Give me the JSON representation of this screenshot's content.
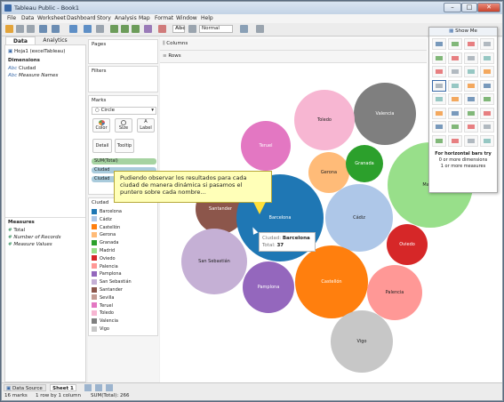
{
  "window": {
    "title": "Tableau Public - Book1",
    "minimize": "–",
    "maximize": "□",
    "close": "✕"
  },
  "menu": [
    "File",
    "Data",
    "Worksheet",
    "Dashboard",
    "Story",
    "Analysis",
    "Map",
    "Format",
    "Window",
    "Help"
  ],
  "toolbar": {
    "text_icon": "Abc",
    "fit": "Normal"
  },
  "tabs": {
    "data": "Data",
    "analytics": "Analytics"
  },
  "data_panel": {
    "source": "Hoja1 (excelTableau)",
    "dimensions_header": "Dimensions",
    "dimensions": [
      {
        "icon": "Abc",
        "label": "Ciudad"
      },
      {
        "icon": "Abc",
        "label": "Measure Names"
      }
    ],
    "measures_header": "Measures",
    "measures": [
      {
        "icon": "#",
        "label": "Total"
      },
      {
        "icon": "#",
        "label": "Number of Records"
      },
      {
        "icon": "#",
        "label": "Measure Values"
      }
    ]
  },
  "cards": {
    "pages": "Pages",
    "filters": "Filters",
    "marks": "Marks",
    "mark_type": "Circle",
    "color": "Color",
    "size": "Size",
    "label": "Label",
    "detail": "Detail",
    "tooltip": "Tooltip",
    "pill_sum": "SUM(Total)",
    "pill_ciudad1": "Ciudad",
    "pill_ciudad2": "Ciudad"
  },
  "legend": {
    "title": "Ciudad",
    "items": [
      {
        "label": "Barcelona",
        "color": "#1f77b4"
      },
      {
        "label": "Cádiz",
        "color": "#aec7e8"
      },
      {
        "label": "Castellón",
        "color": "#ff7f0e"
      },
      {
        "label": "Gerona",
        "color": "#ffbb78"
      },
      {
        "label": "Granada",
        "color": "#2ca02c"
      },
      {
        "label": "Madrid",
        "color": "#98df8a"
      },
      {
        "label": "Oviedo",
        "color": "#d62728"
      },
      {
        "label": "Palencia",
        "color": "#ff9896"
      },
      {
        "label": "Pamplona",
        "color": "#9467bd"
      },
      {
        "label": "San Sebastián",
        "color": "#c5b0d5"
      },
      {
        "label": "Santander",
        "color": "#8c564b"
      },
      {
        "label": "Sevilla",
        "color": "#c49c94"
      },
      {
        "label": "Teruel",
        "color": "#e377c2"
      },
      {
        "label": "Toledo",
        "color": "#f7b6d2"
      },
      {
        "label": "Valencia",
        "color": "#7f7f7f"
      },
      {
        "label": "Vigo",
        "color": "#c7c7c7"
      }
    ]
  },
  "shelves": {
    "columns": "Columns",
    "rows": "Rows"
  },
  "bubbles": [
    {
      "label": "Valencia",
      "color": "#7f7f7f"
    },
    {
      "label": "Toledo",
      "color": "#f7b6d2"
    },
    {
      "label": "Teruel",
      "color": "#e377c2"
    },
    {
      "label": "Gerona",
      "color": "#ffbb78"
    },
    {
      "label": "Granada",
      "color": "#2ca02c"
    },
    {
      "label": "Madrid",
      "color": "#98df8a"
    },
    {
      "label": "Santander",
      "color": "#8c564b"
    },
    {
      "label": "Barcelona",
      "color": "#1f77b4"
    },
    {
      "label": "Cádiz",
      "color": "#aec7e8"
    },
    {
      "label": "Oviedo",
      "color": "#d62728"
    },
    {
      "label": "San Sebastián",
      "color": "#c5b0d5"
    },
    {
      "label": "Castellón",
      "color": "#ff7f0e"
    },
    {
      "label": "Palencia",
      "color": "#ff9896"
    },
    {
      "label": "Pamplona",
      "color": "#9467bd"
    },
    {
      "label": "Vigo",
      "color": "#c7c7c7"
    }
  ],
  "callout": "Pudiendo observar los resultados para cada ciudad de manera dinámica si pasamos el puntero sobre cada nombre…",
  "tooltip": {
    "ciudad_label": "Ciudad:",
    "ciudad_value": "Barcelona",
    "total_label": "Total:",
    "total_value": "37"
  },
  "show_me": {
    "title": "Show Me",
    "hint_line1": "For horizontal bars try",
    "hint_line2": "0 or more dimensions",
    "hint_line3": "1 or more measures"
  },
  "status": {
    "data_source": "Data Source",
    "sheet": "Sheet 1",
    "marks": "16 marks",
    "dims": "1 row by 1 column",
    "sum": "SUM(Total): 266"
  }
}
